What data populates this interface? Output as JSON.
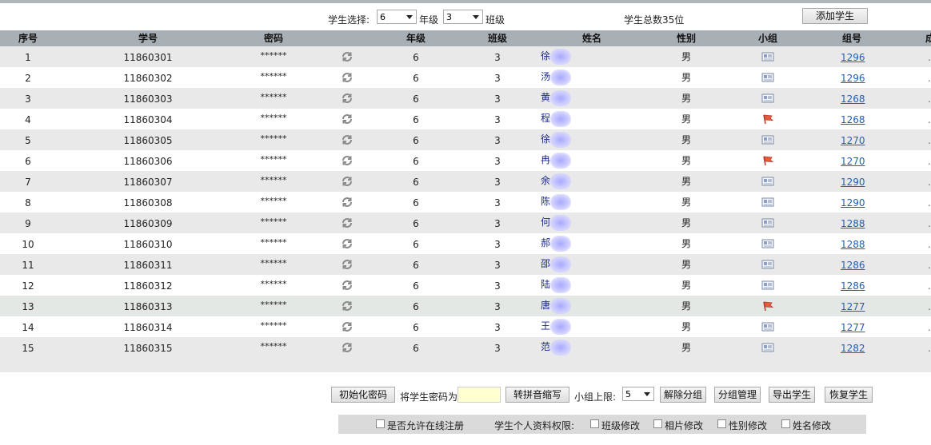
{
  "filter": {
    "student_select_label": "学生选择:",
    "grade_value": "6",
    "grade_label": "年级",
    "class_value": "3",
    "class_label": "班级",
    "total_text": "学生总数35位",
    "add_student_label": "添加学生"
  },
  "table": {
    "headers": {
      "index": "序号",
      "student_id": "学号",
      "password": "密码",
      "grade": "年级",
      "class": "班级",
      "name": "姓名",
      "gender": "性别",
      "group": "小组",
      "group_no": "组号",
      "extra": "成"
    },
    "rows": [
      {
        "index": "1",
        "student_id": "11860301",
        "password": "******",
        "grade": "6",
        "class": "3",
        "name_first": "徐",
        "gender": "男",
        "group_icon": "card-icon",
        "group_no": "1296"
      },
      {
        "index": "2",
        "student_id": "11860302",
        "password": "******",
        "grade": "6",
        "class": "3",
        "name_first": "汤",
        "gender": "男",
        "group_icon": "card-icon",
        "group_no": "1296"
      },
      {
        "index": "3",
        "student_id": "11860303",
        "password": "******",
        "grade": "6",
        "class": "3",
        "name_first": "黄",
        "gender": "男",
        "group_icon": "card-icon",
        "group_no": "1268"
      },
      {
        "index": "4",
        "student_id": "11860304",
        "password": "******",
        "grade": "6",
        "class": "3",
        "name_first": "程",
        "gender": "男",
        "group_icon": "flag-icon",
        "group_no": "1268"
      },
      {
        "index": "5",
        "student_id": "11860305",
        "password": "******",
        "grade": "6",
        "class": "3",
        "name_first": "徐",
        "gender": "男",
        "group_icon": "card-icon",
        "group_no": "1270"
      },
      {
        "index": "6",
        "student_id": "11860306",
        "password": "******",
        "grade": "6",
        "class": "3",
        "name_first": "冉",
        "gender": "男",
        "group_icon": "flag-icon",
        "group_no": "1270"
      },
      {
        "index": "7",
        "student_id": "11860307",
        "password": "******",
        "grade": "6",
        "class": "3",
        "name_first": "余",
        "gender": "男",
        "group_icon": "card-icon",
        "group_no": "1290"
      },
      {
        "index": "8",
        "student_id": "11860308",
        "password": "******",
        "grade": "6",
        "class": "3",
        "name_first": "陈",
        "gender": "男",
        "group_icon": "card-icon",
        "group_no": "1290"
      },
      {
        "index": "9",
        "student_id": "11860309",
        "password": "******",
        "grade": "6",
        "class": "3",
        "name_first": "何",
        "gender": "男",
        "group_icon": "card-icon",
        "group_no": "1288"
      },
      {
        "index": "10",
        "student_id": "11860310",
        "password": "******",
        "grade": "6",
        "class": "3",
        "name_first": "郝",
        "gender": "男",
        "group_icon": "card-icon",
        "group_no": "1288"
      },
      {
        "index": "11",
        "student_id": "11860311",
        "password": "******",
        "grade": "6",
        "class": "3",
        "name_first": "邵",
        "gender": "男",
        "group_icon": "card-icon",
        "group_no": "1286"
      },
      {
        "index": "12",
        "student_id": "11860312",
        "password": "******",
        "grade": "6",
        "class": "3",
        "name_first": "陆",
        "gender": "男",
        "group_icon": "card-icon",
        "group_no": "1286"
      },
      {
        "index": "13",
        "student_id": "11860313",
        "password": "******",
        "grade": "6",
        "class": "3",
        "name_first": "唐",
        "gender": "男",
        "group_icon": "flag-icon",
        "group_no": "1277"
      },
      {
        "index": "14",
        "student_id": "11860314",
        "password": "******",
        "grade": "6",
        "class": "3",
        "name_first": "王",
        "gender": "男",
        "group_icon": "card-icon",
        "group_no": "1277"
      },
      {
        "index": "15",
        "student_id": "11860315",
        "password": "******",
        "grade": "6",
        "class": "3",
        "name_first": "范",
        "gender": "男",
        "group_icon": "card-icon",
        "group_no": "1282"
      }
    ]
  },
  "actions": {
    "init_password_label": "初始化密码",
    "set_password_label": "将学生密码为",
    "pinyin_label": "转拼音缩写",
    "group_limit_label": "小组上限:",
    "group_limit_value": "5",
    "ungroup_label": "解除分组",
    "group_manage_label": "分组管理",
    "export_label": "导出学生",
    "restore_label": "恢复学生"
  },
  "permissions": {
    "online_register_label": "是否允许在线注册",
    "profile_permission_label": "学生个人资料权限:",
    "class_edit_label": "班级修改",
    "photo_edit_label": "相片修改",
    "gender_edit_label": "性别修改",
    "name_edit_label": "姓名修改"
  },
  "colors": {
    "header_bg": "#a9b0b5",
    "row_alt_bg": "#e9e9e9",
    "link": "#1f5fbf",
    "name_text": "#1b2a8c",
    "password_input_bg": "#ffffd0"
  }
}
